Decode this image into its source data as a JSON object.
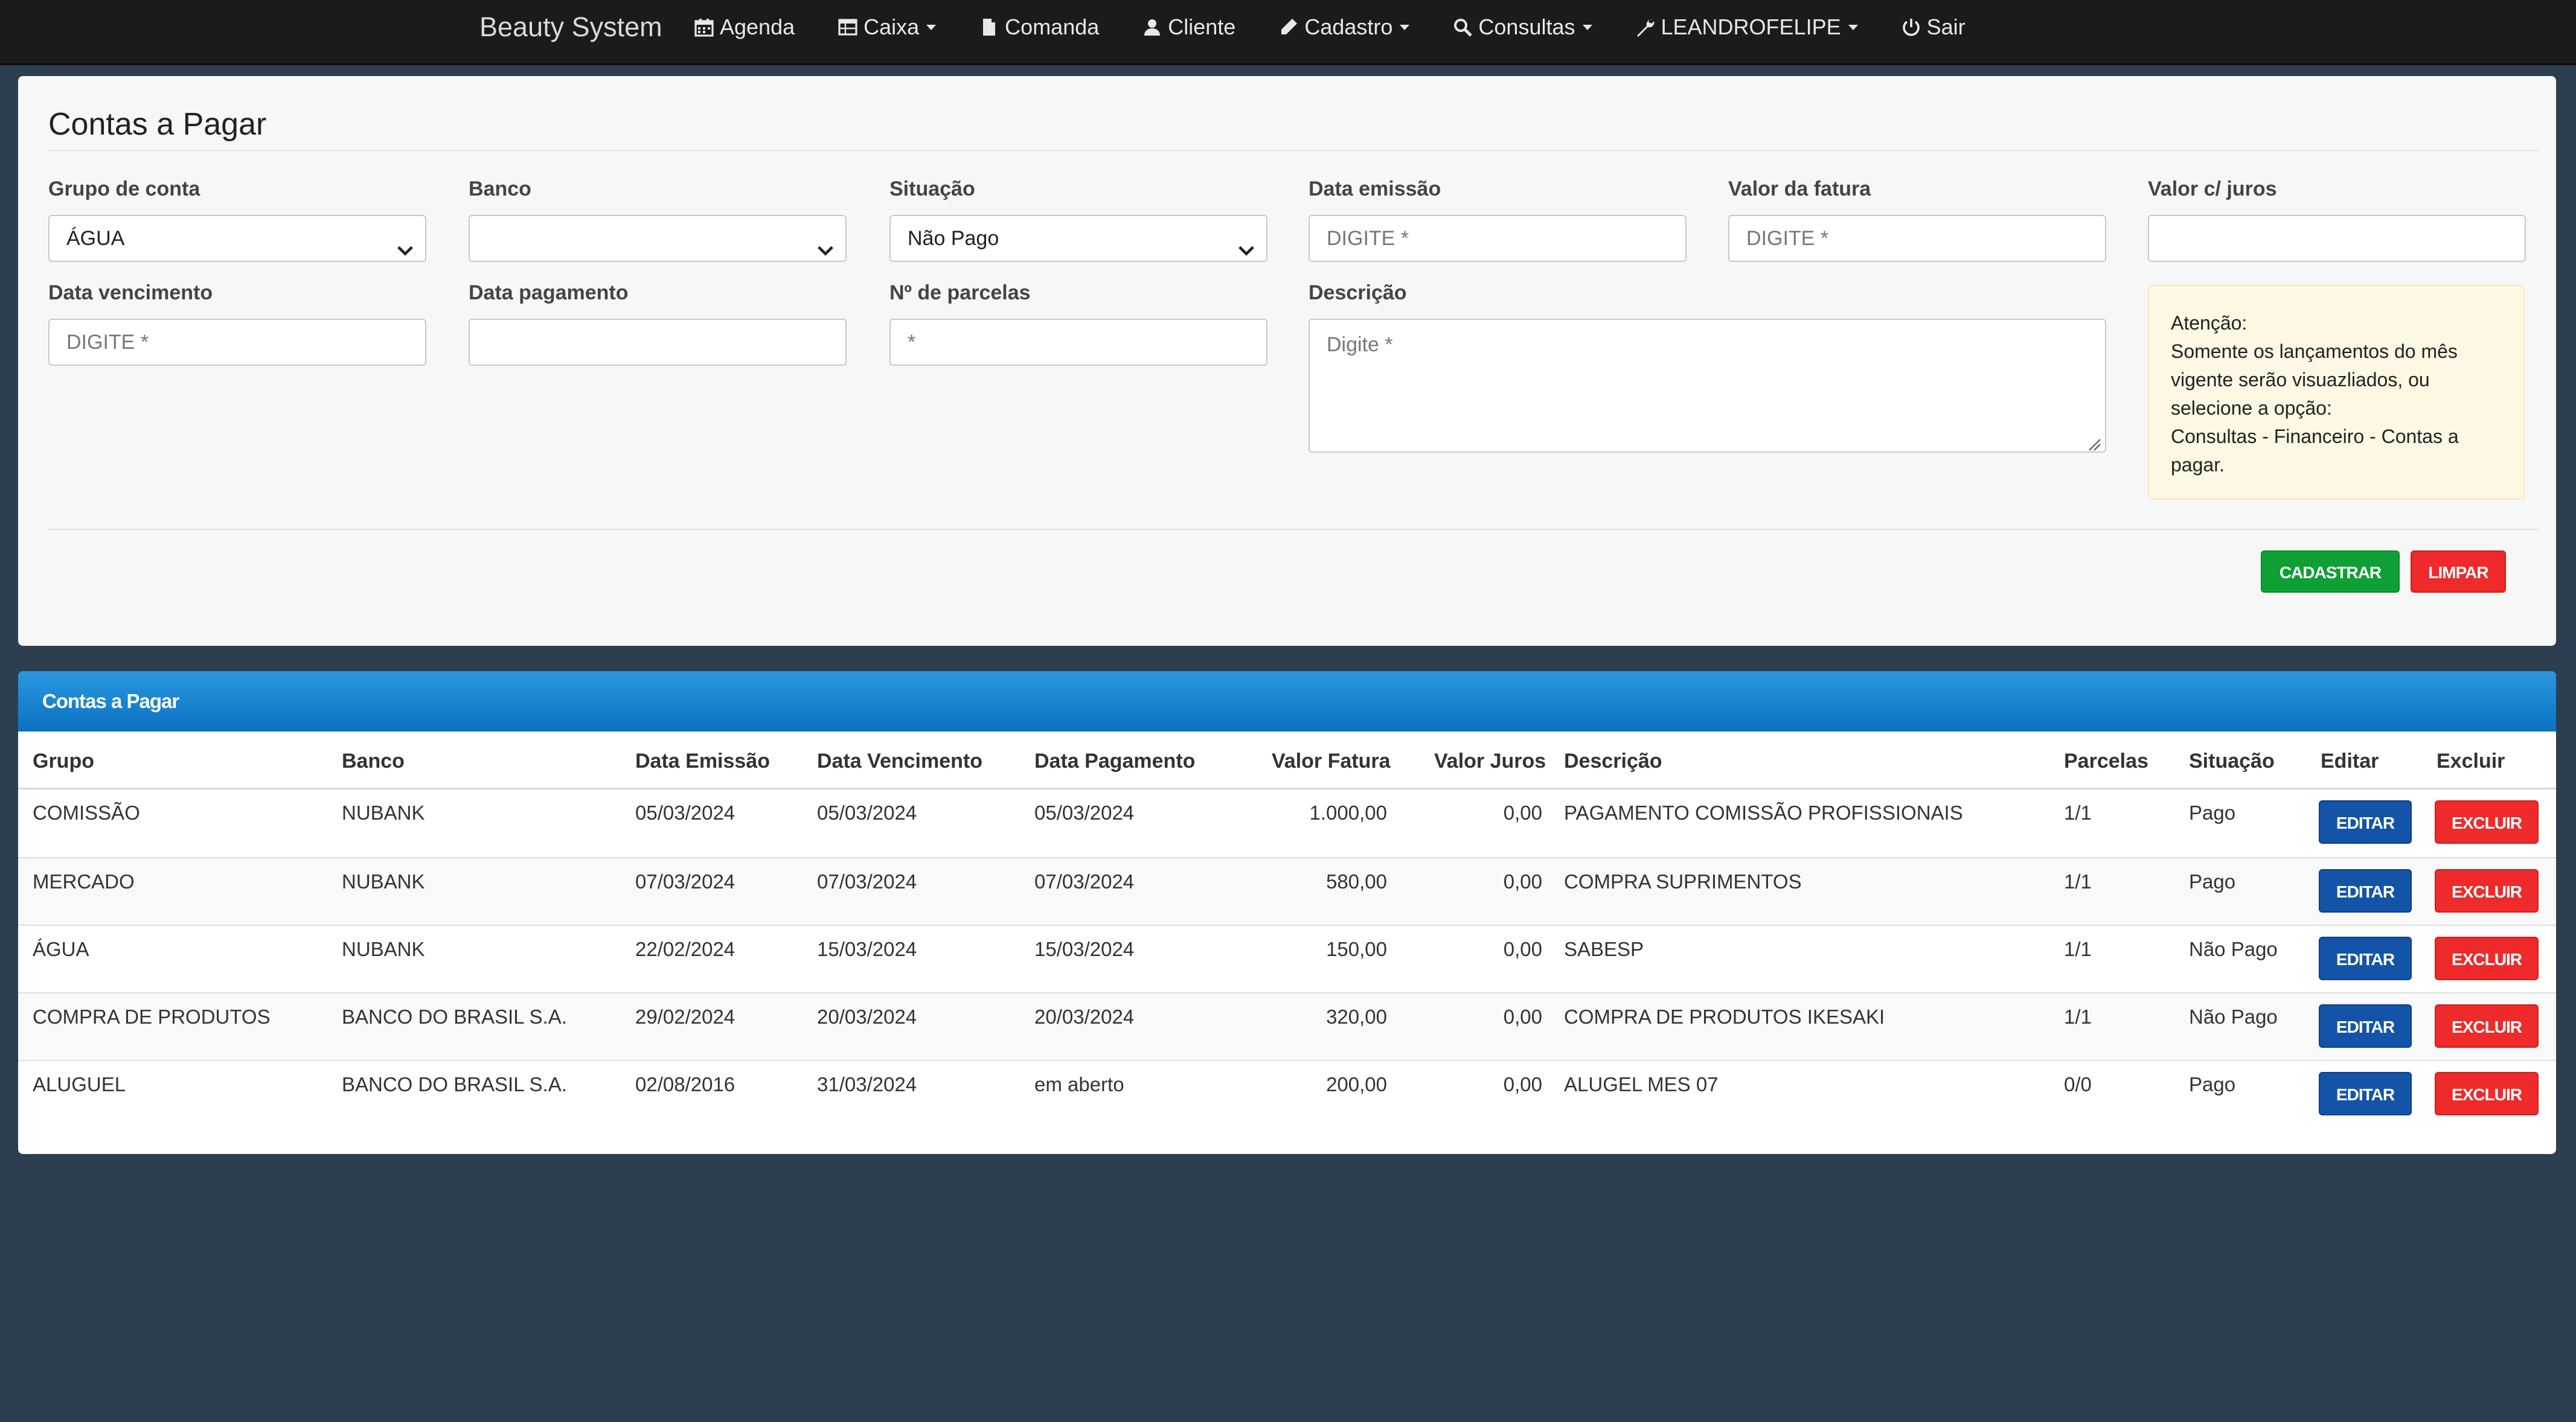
{
  "navbar": {
    "brand": "Beauty System",
    "items": [
      {
        "label": "Agenda",
        "icon": "calendar-icon",
        "caret": false
      },
      {
        "label": "Caixa",
        "icon": "table-icon",
        "caret": true
      },
      {
        "label": "Comanda",
        "icon": "file-icon",
        "caret": false
      },
      {
        "label": "Cliente",
        "icon": "user-icon",
        "caret": false
      },
      {
        "label": "Cadastro",
        "icon": "pencil-icon",
        "caret": true
      },
      {
        "label": "Consultas",
        "icon": "search-icon",
        "caret": true
      },
      {
        "label": "LEANDROFELIPE",
        "icon": "wrench-icon",
        "caret": true
      },
      {
        "label": "Sair",
        "icon": "power-icon",
        "caret": false
      }
    ]
  },
  "form": {
    "title": "Contas a Pagar",
    "grupo_label": "Grupo de conta",
    "grupo_value": "ÁGUA",
    "banco_label": "Banco",
    "banco_value": "",
    "situacao_label": "Situação",
    "situacao_value": "Não Pago",
    "emissao_label": "Data emissão",
    "emissao_placeholder": "DIGITE *",
    "valor_label": "Valor da fatura",
    "valor_placeholder": "DIGITE *",
    "juros_label": "Valor c/ juros",
    "juros_placeholder": "",
    "vencimento_label": "Data vencimento",
    "vencimento_placeholder": "DIGITE *",
    "pagamento_label": "Data pagamento",
    "pagamento_placeholder": "",
    "parcelas_label": "Nº de parcelas",
    "parcelas_placeholder": "*",
    "descricao_label": "Descrição",
    "descricao_placeholder": "Digite *",
    "alert_lines": [
      "Atenção:",
      "Somente os lançamentos do mês",
      "vigente serão visuazliados, ou",
      "selecione a opção:",
      "Consultas - Financeiro - Contas a",
      "pagar."
    ],
    "cadastrar_label": "CADASTRAR",
    "limpar_label": "LIMPAR"
  },
  "table": {
    "title": "Contas a Pagar",
    "headers": [
      "Grupo",
      "Banco",
      "Data Emissão",
      "Data Vencimento",
      "Data Pagamento",
      "Valor Fatura",
      "Valor Juros",
      "Descrição",
      "Parcelas",
      "Situação",
      "Editar",
      "Excluir"
    ],
    "edit_label": "EDITAR",
    "delete_label": "EXCLUIR",
    "rows": [
      {
        "grupo": "COMISSÃO",
        "banco": "NUBANK",
        "emissao": "05/03/2024",
        "vencimento": "05/03/2024",
        "pagamento": "05/03/2024",
        "valor": "1.000,00",
        "juros": "0,00",
        "descricao": "PAGAMENTO COMISSÃO PROFISSIONAIS",
        "parcelas": "1/1",
        "situacao": "Pago"
      },
      {
        "grupo": "MERCADO",
        "banco": "NUBANK",
        "emissao": "07/03/2024",
        "vencimento": "07/03/2024",
        "pagamento": "07/03/2024",
        "valor": "580,00",
        "juros": "0,00",
        "descricao": "COMPRA SUPRIMENTOS",
        "parcelas": "1/1",
        "situacao": "Pago"
      },
      {
        "grupo": "ÁGUA",
        "banco": "NUBANK",
        "emissao": "22/02/2024",
        "vencimento": "15/03/2024",
        "pagamento": "15/03/2024",
        "valor": "150,00",
        "juros": "0,00",
        "descricao": "SABESP",
        "parcelas": "1/1",
        "situacao": "Não Pago"
      },
      {
        "grupo": "COMPRA DE PRODUTOS",
        "banco": "BANCO DO BRASIL S.A.",
        "emissao": "29/02/2024",
        "vencimento": "20/03/2024",
        "pagamento": "20/03/2024",
        "valor": "320,00",
        "juros": "0,00",
        "descricao": "COMPRA DE PRODUTOS IKESAKI",
        "parcelas": "1/1",
        "situacao": "Não Pago"
      },
      {
        "grupo": "ALUGUEL",
        "banco": "BANCO DO BRASIL S.A.",
        "emissao": "02/08/2016",
        "vencimento": "31/03/2024",
        "pagamento": "em aberto",
        "valor": "200,00",
        "juros": "0,00",
        "descricao": "ALUGEL MES 07",
        "parcelas": "0/0",
        "situacao": "Pago"
      }
    ]
  }
}
